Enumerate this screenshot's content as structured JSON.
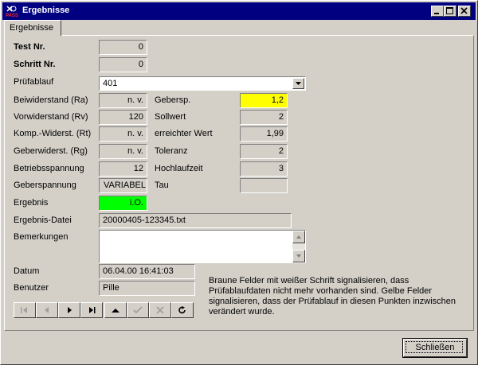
{
  "window": {
    "title": "Ergebnisse",
    "icon": "pass-app-icon"
  },
  "tab": {
    "label": "Ergebnisse"
  },
  "form": {
    "test_nr": {
      "label": "Test Nr.",
      "value": "0"
    },
    "schritt_nr": {
      "label": "Schritt Nr.",
      "value": "0"
    },
    "pruefablauf": {
      "label": "Prüfablauf",
      "value": "401"
    },
    "beiwiderstand": {
      "label": "Beiwiderstand (Ra)",
      "value": "n. v."
    },
    "vorwiderstand": {
      "label": "Vorwiderstand (Rv)",
      "value": "120"
    },
    "komp_widerst": {
      "label": "Komp.-Widerst. (Rt)",
      "value": "n. v."
    },
    "geberwiderst": {
      "label": "Geberwiderst. (Rg)",
      "value": "n. v."
    },
    "betriebsspannung": {
      "label": "Betriebsspannung",
      "value": "12"
    },
    "geberspannung": {
      "label": "Geberspannung",
      "value": "VARIABEL"
    },
    "ergebnis": {
      "label": "Ergebnis",
      "value": "i.O."
    },
    "ergebnis_datei": {
      "label": "Ergebnis-Datei",
      "value": "20000405-123345.txt"
    },
    "bemerkungen": {
      "label": "Bemerkungen",
      "value": ""
    },
    "datum": {
      "label": "Datum",
      "value": "06.04.00 16:41:03"
    },
    "benutzer": {
      "label": "Benutzer",
      "value": "Pille"
    },
    "gebersp": {
      "label": "Gebersp.",
      "value": "1,2"
    },
    "sollwert": {
      "label": "Sollwert",
      "value": "2"
    },
    "erreichter_wert": {
      "label": "erreichter Wert",
      "value": "1,99"
    },
    "toleranz": {
      "label": "Toleranz",
      "value": "2"
    },
    "hochlaufzeit": {
      "label": "Hochlaufzeit",
      "value": "3"
    },
    "tau": {
      "label": "Tau",
      "value": ""
    }
  },
  "note": "Braune Felder mit weißer Schrift signalisieren, dass Prüfablaufdaten nicht mehr vorhanden sind. Gelbe Felder signalisieren, dass der Prüfablauf in diesen Punkten inzwischen verändert wurde.",
  "navigator": [
    "first-icon",
    "prior-icon",
    "next-icon",
    "last-icon",
    "insert-icon",
    "post-icon",
    "cancel-icon",
    "refresh-icon"
  ],
  "buttons": {
    "close": "Schließen"
  },
  "colors": {
    "titlebar": "#000080",
    "changed_field": "#ffff00",
    "result_ok": "#00ff00",
    "face": "#d4d0c8"
  }
}
